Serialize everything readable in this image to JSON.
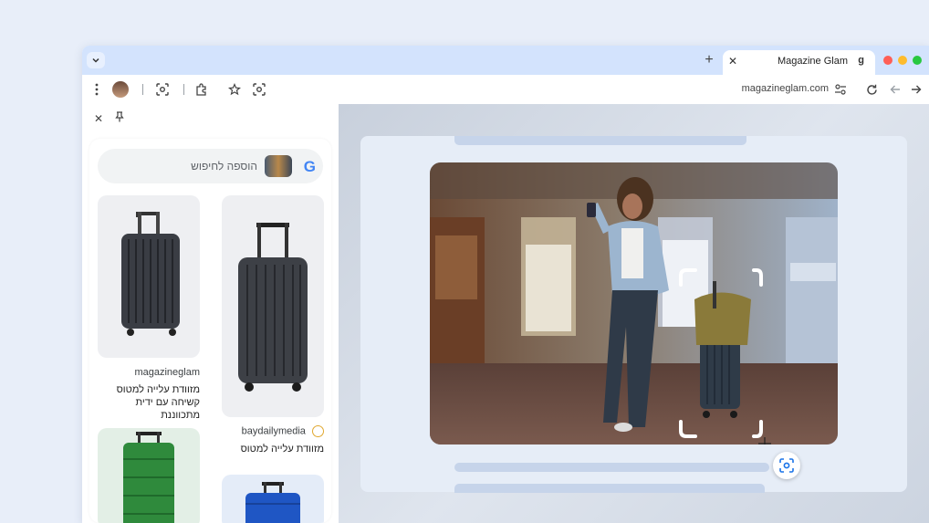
{
  "browser": {
    "tab_title": "Magazine Glam",
    "new_tab_symbol": "+",
    "tab_close_symbol": "✕",
    "tab_favicon_symbol": "g",
    "url": "magazineglam.com"
  },
  "side_panel": {
    "close_symbol": "✕",
    "pin_symbol": "📌",
    "search_placeholder": "הוספה לחיפוש",
    "google_logo": "G",
    "results": [
      {
        "source": "magazineglam",
        "title_line1": "מזוודת עלייה למטוס",
        "title_line2": "קשיחה עם ידית מתכווננת",
        "color": "dark-gray"
      },
      {
        "source": "baydailymedia",
        "title_line1": "מזוודת עלייה למטוס",
        "color": "charcoal"
      },
      {
        "color": "green"
      },
      {
        "color": "blue"
      }
    ]
  },
  "content": {
    "site_name": "magazineglam.com"
  },
  "colors": {
    "tabstrip": "#d3e3fd",
    "accent_blue": "#1a73e8",
    "page_bg": "#e6edf7"
  }
}
